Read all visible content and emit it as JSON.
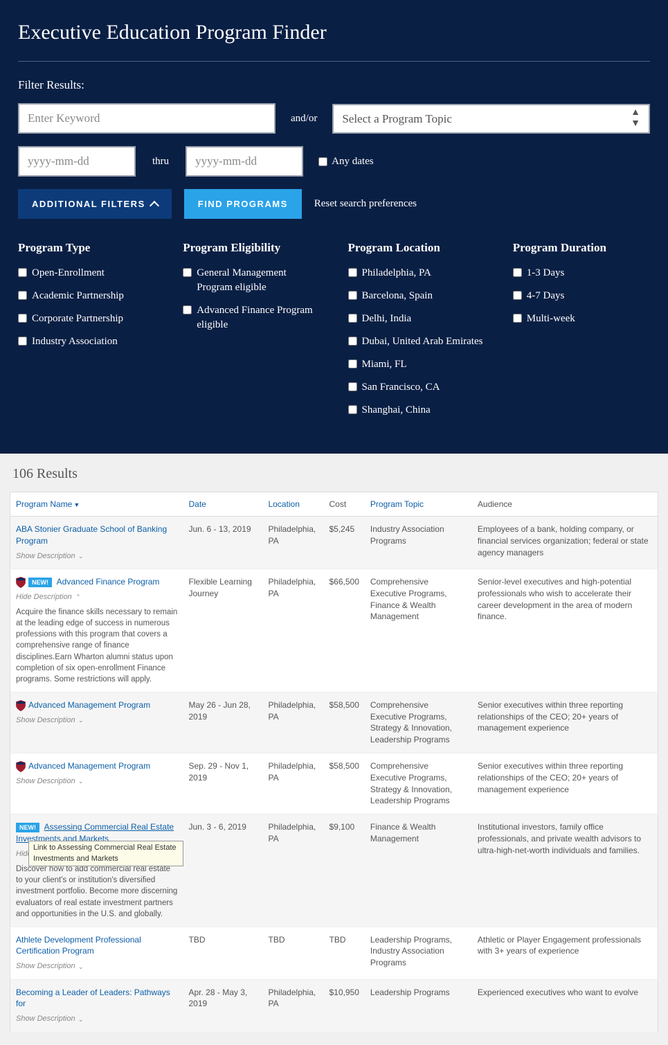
{
  "title": "Executive Education Program Finder",
  "filter_label": "Filter Results:",
  "keyword_placeholder": "Enter Keyword",
  "andor": "and/or",
  "topic_placeholder": "Select a Program Topic",
  "date_placeholder": "yyyy-mm-dd",
  "thru": "thru",
  "any_dates": "Any dates",
  "btn_additional": "ADDITIONAL FILTERS",
  "btn_find": "FIND PROGRAMS",
  "reset": "Reset search preferences",
  "groups": {
    "type": {
      "title": "Program Type",
      "items": [
        "Open-Enrollment",
        "Academic Partnership",
        "Corporate Partnership",
        "Industry Association"
      ]
    },
    "elig": {
      "title": "Program Eligibility",
      "items": [
        "General Management Program eligible",
        "Advanced Finance Program eligible"
      ]
    },
    "loc": {
      "title": "Program Location",
      "items": [
        "Philadelphia, PA",
        "Barcelona, Spain",
        "Delhi, India",
        "Dubai, United Arab Emirates",
        "Miami, FL",
        "San Francisco, CA",
        "Shanghai, China"
      ]
    },
    "dur": {
      "title": "Program Duration",
      "items": [
        "1-3 Days",
        "4-7 Days",
        "Multi-week"
      ]
    }
  },
  "results_count": "106 Results",
  "headers": {
    "name": "Program Name",
    "date": "Date",
    "location": "Location",
    "cost": "Cost",
    "topic": "Program Topic",
    "audience": "Audience"
  },
  "show_desc": "Show Description",
  "hide_desc": "Hide Description",
  "new_badge": "NEW!",
  "tooltip_text": "Link to Assessing Commercial Real Estate Investments and Markets",
  "rows": [
    {
      "name": "ABA Stonier Graduate School of Banking Program",
      "date": "Jun. 6 - 13, 2019",
      "location": "Philadelphia, PA",
      "cost": "$5,245",
      "topic": "Industry Association Programs",
      "audience": "Employees of a bank, holding company, or financial services organization; federal or state agency managers",
      "alt": true,
      "shield": false,
      "new": false,
      "expanded": false
    },
    {
      "name": "Advanced Finance Program",
      "date": "Flexible Learning Journey",
      "location": "Philadelphia, PA",
      "cost": "$66,500",
      "topic": "Comprehensive Executive Programs, Finance & Wealth Management",
      "audience": "Senior-level executives and high-potential professionals who wish to accelerate their career development in the area of modern finance.",
      "alt": false,
      "shield": true,
      "new": true,
      "expanded": true,
      "desc": "Acquire the finance skills necessary to remain at the leading edge of success in numerous professions with this program that covers a comprehensive range of finance disciplines.Earn Wharton alumni status upon completion of six open-enrollment Finance programs. Some restrictions will apply."
    },
    {
      "name": "Advanced Management Program",
      "date": "May 26 - Jun 28, 2019",
      "location": "Philadelphia, PA",
      "cost": "$58,500",
      "topic": "Comprehensive Executive Programs, Strategy & Innovation, Leadership Programs",
      "audience": "Senior executives within three reporting relationships of the CEO; 20+ years of management experience",
      "alt": true,
      "shield": true,
      "new": false,
      "expanded": false
    },
    {
      "name": "Advanced Management Program",
      "date": "Sep. 29 - Nov 1, 2019",
      "location": "Philadelphia, PA",
      "cost": "$58,500",
      "topic": "Comprehensive Executive Programs, Strategy & Innovation, Leadership Programs",
      "audience": "Senior executives within three reporting relationships of the CEO; 20+ years of management experience",
      "alt": false,
      "shield": true,
      "new": false,
      "expanded": false
    },
    {
      "name": "Assessing Commercial Real Estate Investments and Markets",
      "date": "Jun. 3 - 6, 2019",
      "location": "Philadelphia, PA",
      "cost": "$9,100",
      "topic": "Finance & Wealth Management",
      "audience": "Institutional investors, family office professionals, and private wealth advisors to ultra-high-net-worth individuals and families.",
      "alt": true,
      "shield": false,
      "new": true,
      "expanded": true,
      "underline": true,
      "tooltip": true,
      "desc": "Discover how to add commercial real estate to your client's or institution's diversified investment portfolio. Become more discerning evaluators of real estate investment partners and opportunities in the U.S. and globally."
    },
    {
      "name": "Athlete Development Professional Certification Program",
      "date": "TBD",
      "location": "TBD",
      "cost": "TBD",
      "topic": "Leadership Programs, Industry Association Programs",
      "audience": "Athletic or Player Engagement professionals with 3+ years of experience",
      "alt": false,
      "shield": false,
      "new": false,
      "expanded": false
    },
    {
      "name": "Becoming a Leader of Leaders: Pathways for",
      "date": "Apr. 28 - May 3, 2019",
      "location": "Philadelphia, PA",
      "cost": "$10,950",
      "topic": "Leadership Programs",
      "audience": "Experienced executives who want to evolve",
      "alt": true,
      "shield": false,
      "new": false,
      "expanded": false
    }
  ]
}
